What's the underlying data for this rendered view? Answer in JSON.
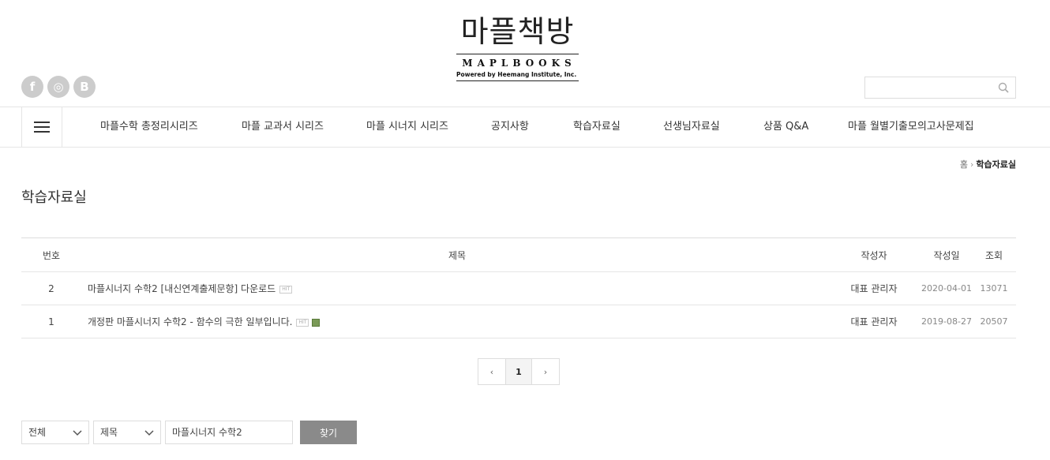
{
  "logo": {
    "korean": "마플책방",
    "english": "MAPLBOOKS",
    "tagline": "Powered by Heemang Institute, Inc."
  },
  "sns": [
    {
      "icon": "facebook-icon",
      "glyph": "f"
    },
    {
      "icon": "instagram-icon",
      "glyph": "◎"
    },
    {
      "icon": "blog-icon",
      "glyph": "B"
    }
  ],
  "search": {
    "placeholder": "",
    "value": ""
  },
  "nav": {
    "items": [
      "마플수학 총정리시리즈",
      "마플 교과서 시리즈",
      "마플 시너지 시리즈",
      "공지사항",
      "학습자료실",
      "선생님자료실",
      "상품 Q&A",
      "마플 월별기출모의고사문제집"
    ]
  },
  "breadcrumb": {
    "home": "홈",
    "separator": "›",
    "current": "학습자료실"
  },
  "page_title": "학습자료실",
  "table": {
    "headers": {
      "num": "번호",
      "title": "제목",
      "writer": "작성자",
      "date": "작성일",
      "hits": "조회"
    },
    "rows": [
      {
        "num": "2",
        "title": "마플시너지 수학2 [내신연계출제문항] 다운로드",
        "hit_badge": "HIT",
        "has_file": false,
        "writer": "대표 관리자",
        "date": "2020-04-01",
        "hits": "13071"
      },
      {
        "num": "1",
        "title": "개정판 마플시너지 수학2 - 함수의 극한 일부입니다.",
        "hit_badge": "HIT",
        "has_file": true,
        "writer": "대표 관리자",
        "date": "2019-08-27",
        "hits": "20507"
      }
    ]
  },
  "pagination": {
    "prev": "‹",
    "current": "1",
    "next": "›"
  },
  "search_form": {
    "scope": "전체",
    "field": "제목",
    "keyword": "마플시너지 수학2",
    "button": "찾기"
  }
}
